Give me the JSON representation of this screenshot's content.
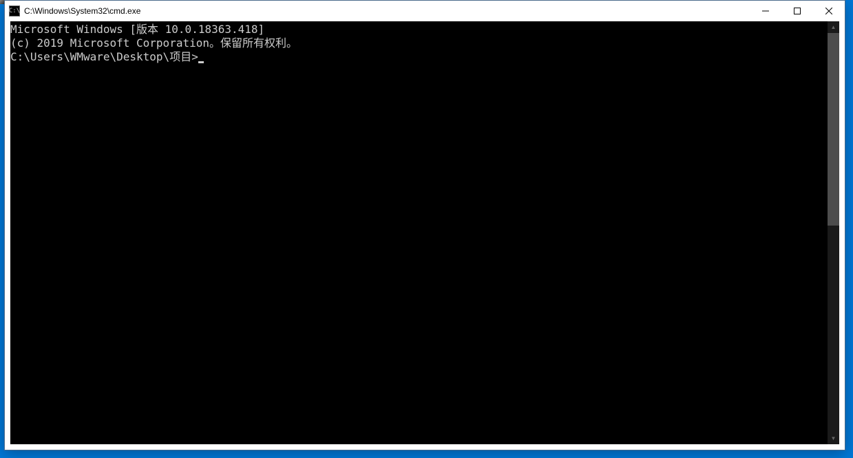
{
  "window": {
    "title": "C:\\Windows\\System32\\cmd.exe",
    "icon_label": "C:\\"
  },
  "controls": {
    "minimize": "Minimize",
    "maximize": "Maximize",
    "close": "Close"
  },
  "terminal": {
    "line1": "Microsoft Windows [版本 10.0.18363.418]",
    "line2": "(c) 2019 Microsoft Corporation。保留所有权利。",
    "blank": "",
    "prompt": "C:\\Users\\WMware\\Desktop\\项目>"
  }
}
